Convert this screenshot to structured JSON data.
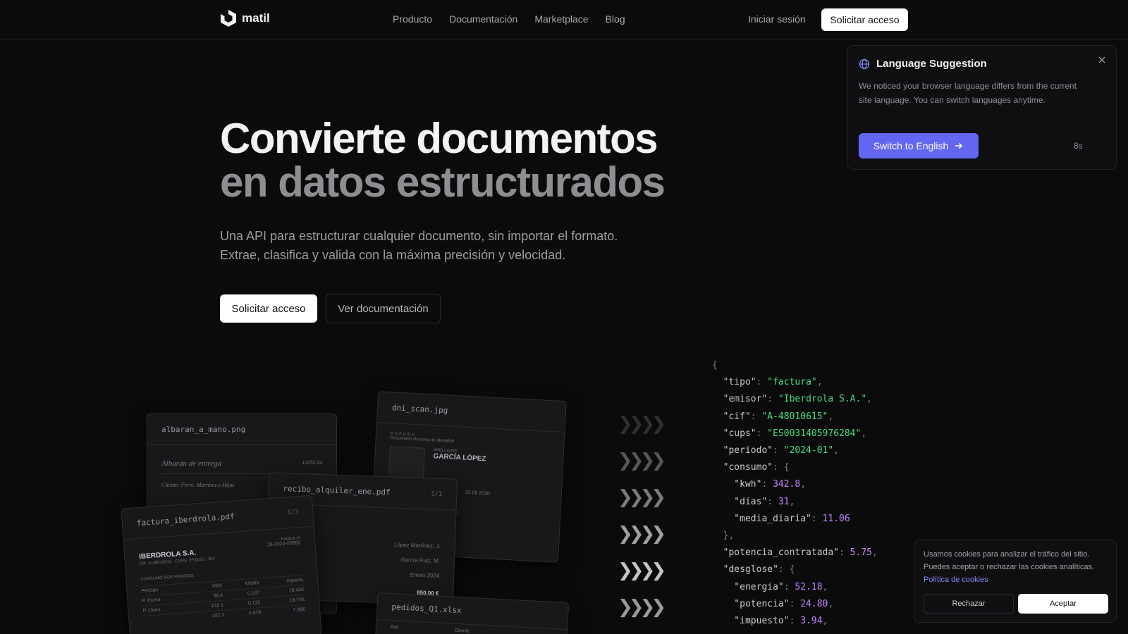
{
  "nav": {
    "logo_text": "matil",
    "links": [
      "Producto",
      "Documentación",
      "Marketplace",
      "Blog"
    ],
    "login": "Iniciar sesión",
    "cta": "Solicitar acceso"
  },
  "hero": {
    "title_line1": "Convierte documentos",
    "title_line2": "en datos estructurados",
    "subtitle_line1": "Una API para estructurar cualquier documento, sin importar el formato.",
    "subtitle_line2": "Extrae, clasifica y valida con la máxima precisión y velocidad.",
    "primary_button": "Solicitar acceso",
    "secondary_button": "Ver documentación"
  },
  "cards": {
    "albaran": {
      "filename": "albaran_a_mano.png",
      "heading": "Albarán de entrega",
      "date": "14/01/24",
      "client": "Cliente: Ferre. Martínez e Hijos"
    },
    "dni": {
      "filename": "dni_scan.jpg",
      "country": "ESPAÑA",
      "doc": "Documento Nacional de Identidad",
      "surname_label": "APELLIDOS",
      "surname": "GARCÍA LÓPEZ",
      "validity": "20 06 2030",
      "mrz": "IDESPAAA000000000000000000"
    },
    "recibo": {
      "filename": "recibo_alquiler_ene.pdf",
      "page": "1/1",
      "label": "ALQUILER",
      "party1": "López Martínez, J.",
      "party2": "García Ruiz, M.",
      "month": "Enero 2024",
      "amount": "850.00 €"
    },
    "factura": {
      "filename": "factura_iberdrola.pdf",
      "page": "1/3",
      "company": "IBERDROLA S.A.",
      "invoice_label": "Factura nº",
      "invoice": "18-2024-00892",
      "cif_line": "CIF: A-48010615 · CUPS: ES0021...284",
      "section": "CONSUMO POR PERIODO",
      "headers": [
        "Periodo",
        "kWh",
        "€/kWh",
        "Importe"
      ],
      "rows": [
        [
          "P. Punta",
          "98.4",
          "0.187",
          "18.40€"
        ],
        [
          "P. Llano",
          "142.1",
          "0.132",
          "18.76€"
        ],
        [
          "",
          "102.3",
          "0.078",
          "7.98€"
        ]
      ]
    },
    "pedidos": {
      "filename": "pedidos_Q1.xlsx",
      "col1": "Ref",
      "col2": "Cliente"
    }
  },
  "json_lines": [
    [
      [
        "p",
        "{"
      ]
    ],
    [
      [
        "k",
        "  \"tipo\""
      ],
      [
        "p",
        ": "
      ],
      [
        "s",
        "\"factura\""
      ],
      [
        "p",
        ","
      ]
    ],
    [
      [
        "k",
        "  \"emisor\""
      ],
      [
        "p",
        ": "
      ],
      [
        "s",
        "\"Iberdrola S.A.\""
      ],
      [
        "p",
        ","
      ]
    ],
    [
      [
        "k",
        "  \"cif\""
      ],
      [
        "p",
        ": "
      ],
      [
        "s",
        "\"A-48010615\""
      ],
      [
        "p",
        ","
      ]
    ],
    [
      [
        "k",
        "  \"cups\""
      ],
      [
        "p",
        ": "
      ],
      [
        "s",
        "\"ES0031405976284\""
      ],
      [
        "p",
        ","
      ]
    ],
    [
      [
        "k",
        "  \"periodo\""
      ],
      [
        "p",
        ": "
      ],
      [
        "s",
        "\"2024-01\""
      ],
      [
        "p",
        ","
      ]
    ],
    [
      [
        "k",
        "  \"consumo\""
      ],
      [
        "p",
        ": {"
      ]
    ],
    [
      [
        "k",
        "    \"kwh\""
      ],
      [
        "p",
        ": "
      ],
      [
        "n",
        "342.8"
      ],
      [
        "p",
        ","
      ]
    ],
    [
      [
        "k",
        "    \"dias\""
      ],
      [
        "p",
        ": "
      ],
      [
        "n",
        "31"
      ],
      [
        "p",
        ","
      ]
    ],
    [
      [
        "k",
        "    \"media_diaria\""
      ],
      [
        "p",
        ": "
      ],
      [
        "n",
        "11.06"
      ]
    ],
    [
      [
        "p",
        "  },"
      ]
    ],
    [
      [
        "k",
        "  \"potencia_contratada\""
      ],
      [
        "p",
        ": "
      ],
      [
        "n",
        "5.75"
      ],
      [
        "p",
        ","
      ]
    ],
    [
      [
        "k",
        "  \"desglose\""
      ],
      [
        "p",
        ": {"
      ]
    ],
    [
      [
        "k",
        "    \"energia\""
      ],
      [
        "p",
        ": "
      ],
      [
        "n",
        "52.18"
      ],
      [
        "p",
        ","
      ]
    ],
    [
      [
        "k",
        "    \"potencia\""
      ],
      [
        "p",
        ": "
      ],
      [
        "n",
        "24.80"
      ],
      [
        "p",
        ","
      ]
    ],
    [
      [
        "k",
        "    \"impuesto\""
      ],
      [
        "p",
        ": "
      ],
      [
        "n",
        "3.94"
      ],
      [
        "p",
        ","
      ]
    ]
  ],
  "language_popup": {
    "title": "Language Suggestion",
    "text": "We noticed your browser language differs from the current site language. You can switch languages anytime.",
    "button": "Switch to English",
    "timer": "8s"
  },
  "cookie_banner": {
    "text": "Usamos cookies para analizar el tráfico del sitio. Puedes aceptar o rechazar las cookies analíticas.",
    "link": "Política de cookies",
    "reject": "Rechazar",
    "accept": "Aceptar"
  },
  "colors": {
    "accent": "#6366f1",
    "json_string": "#4ade80",
    "json_number": "#c084fc",
    "background": "#0b0b0c"
  }
}
